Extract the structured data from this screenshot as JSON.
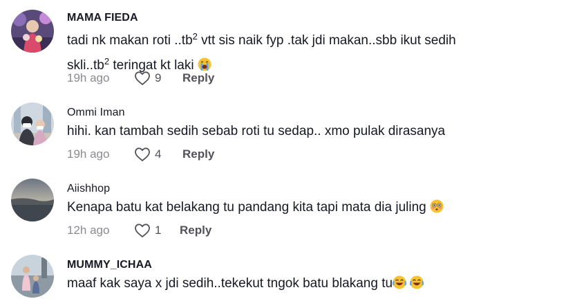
{
  "comments": [
    {
      "username": "MAMA FIEDA",
      "text_line1_a": "tadi nk makan roti ..tb",
      "text_line1_sup": "2",
      "text_line1_b": " vtt sis naik fyp .tak jdi makan..sbb ikut sedih",
      "text_line2_a": "skli..tb",
      "text_line2_sup": "2",
      "text_line2_b": " teringat kt laki",
      "emoji": "loudly-crying-face",
      "time": "19h ago",
      "likes": "9",
      "reply": "Reply"
    },
    {
      "username": "Ommi Iman",
      "text": "hihi. kan tambah sedih sebab roti tu sedap.. xmo pulak dirasanya",
      "time": "19h ago",
      "likes": "4",
      "reply": "Reply"
    },
    {
      "username": "Aiishhop",
      "text": "Kenapa batu kat belakang tu pandang kita tapi mata dia juling ",
      "emoji": "flushed-face",
      "time": "12h ago",
      "likes": "1",
      "reply": "Reply"
    },
    {
      "username": "MUMMY_ICHAA",
      "text": "maaf kak saya x jdi sedih..tekekut tngok batu blakang tu",
      "emoji": "face-with-tears-of-joy"
    }
  ],
  "colors": {
    "text": "#161823",
    "muted": "#8a8b91",
    "secondary": "#515259"
  },
  "icons": {
    "like": "heart-outline-icon"
  }
}
